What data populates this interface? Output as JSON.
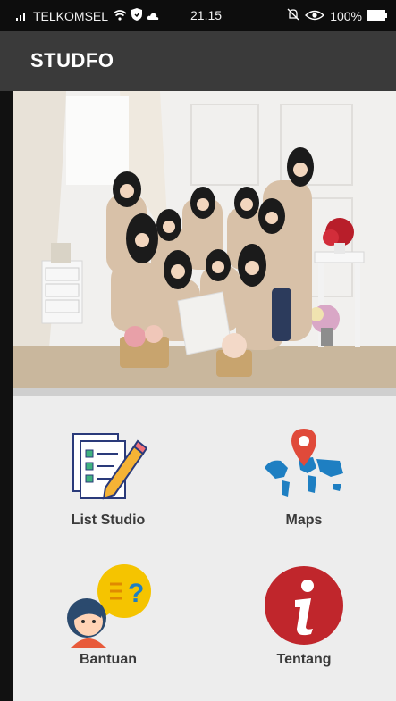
{
  "status_bar": {
    "carrier": "TELKOMSEL",
    "time": "21.15",
    "battery": "100%",
    "icons": [
      "signal-icon",
      "wifi-icon",
      "shield-icon",
      "cloud-icon",
      "alarm-off-icon",
      "eye-icon",
      "battery-icon"
    ]
  },
  "app_bar": {
    "title": "STUDFO"
  },
  "hero": {
    "image": "group-photo"
  },
  "menu": {
    "items": [
      {
        "label": "List Studio",
        "icon": "checklist-pencil-icon"
      },
      {
        "label": "Maps",
        "icon": "world-map-pin-icon"
      },
      {
        "label": "Bantuan",
        "icon": "help-question-icon"
      },
      {
        "label": "Tentang",
        "icon": "info-icon"
      }
    ]
  },
  "colors": {
    "status_bar": "#0d0d0d",
    "app_bar": "#3a3a3a",
    "background": "#ececec",
    "map_blue": "#1e7fc2",
    "pin_red": "#e04a3a",
    "info_red": "#c0262c",
    "help_yellow": "#f5c400"
  }
}
